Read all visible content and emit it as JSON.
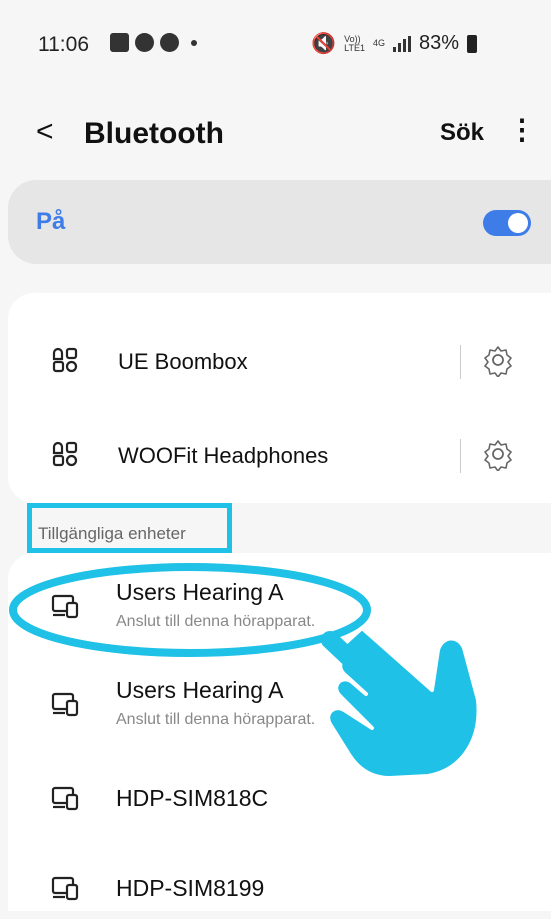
{
  "status_bar": {
    "time": "11:06",
    "battery": "83%",
    "network_top": "Vo))",
    "network_bottom": "LTE1",
    "net_gen": "4G"
  },
  "header": {
    "back_icon": "chevron-left-icon",
    "title": "Bluetooth",
    "search_label": "Sök",
    "more_icon": "more-vert-icon"
  },
  "bluetooth_toggle": {
    "label": "På",
    "state": "on",
    "accent": "#3e7de8"
  },
  "paired_devices": [
    {
      "name": "UE Boombox",
      "icon": "device-grid-icon"
    },
    {
      "name": "WOOFit Headphones",
      "icon": "device-grid-icon"
    }
  ],
  "available_section_label": "Tillgängliga enheter",
  "available_devices": [
    {
      "name": "Users Hearing A",
      "subtitle": "Anslut till denna hörapparat.",
      "icon": "phone-tablet-icon"
    },
    {
      "name": "Users Hearing A",
      "subtitle": "Anslut till denna hörapparat.",
      "icon": "phone-tablet-icon"
    },
    {
      "name": "HDP-SIM818C",
      "icon": "phone-tablet-icon"
    },
    {
      "name": "HDP-SIM8199",
      "icon": "phone-tablet-icon"
    }
  ],
  "annotation_color": "#1fc1e6"
}
